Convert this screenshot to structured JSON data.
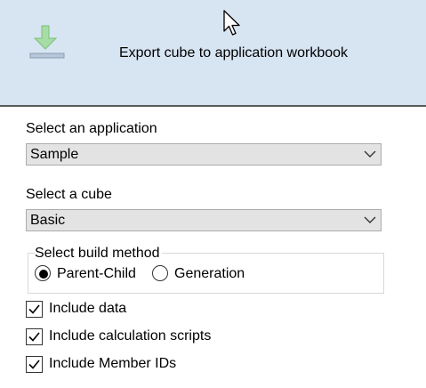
{
  "header": {
    "title": "Export cube to application workbook",
    "icon": "download-arrow-icon",
    "accent": "#8fd08f",
    "background": "#d7e4f2"
  },
  "application": {
    "label": "Select an application",
    "selected": "Sample"
  },
  "cube": {
    "label": "Select a cube",
    "selected": "Basic"
  },
  "build_method": {
    "label": "Select build method",
    "options": [
      {
        "label": "Parent-Child",
        "selected": true
      },
      {
        "label": "Generation",
        "selected": false
      }
    ]
  },
  "options": [
    {
      "label": "Include data",
      "checked": true
    },
    {
      "label": "Include calculation scripts",
      "checked": true
    },
    {
      "label": "Include Member IDs",
      "checked": true
    }
  ]
}
